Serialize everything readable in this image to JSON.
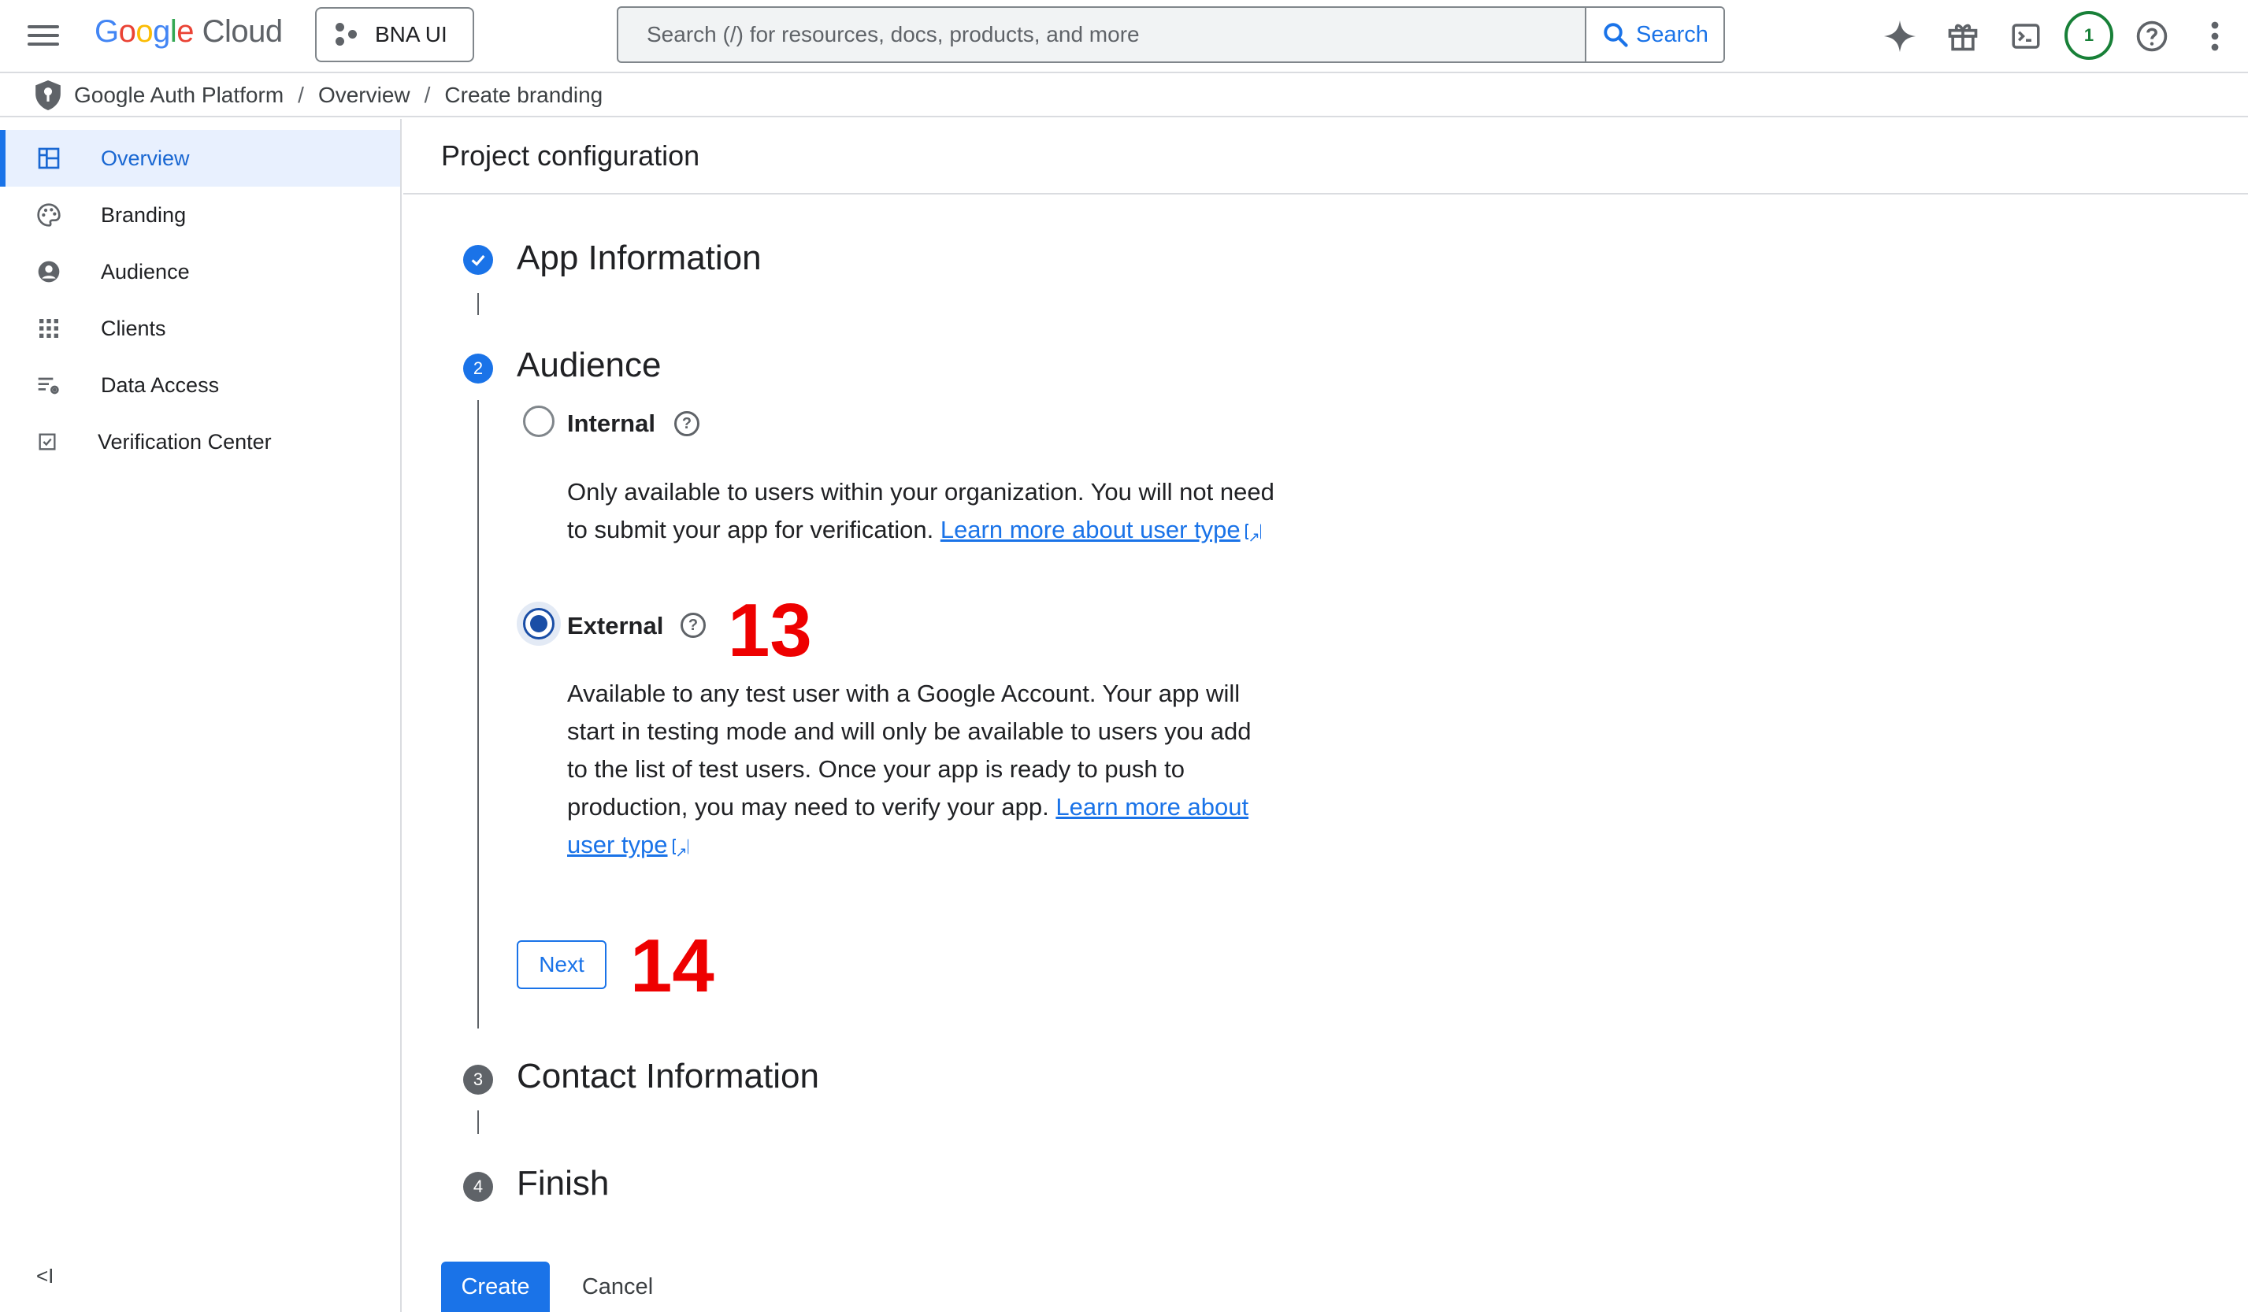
{
  "header": {
    "logo_google": [
      "G",
      "o",
      "o",
      "g",
      "l",
      "e"
    ],
    "logo_cloud": "Cloud",
    "project_name": "BNA UI",
    "search_placeholder": "Search (/) for resources, docs, products, and more",
    "search_button": "Search",
    "account_badge": "1",
    "icons": [
      "menu-icon",
      "gemini-sparkle-icon",
      "gift-icon",
      "cloud-shell-icon",
      "help-icon",
      "more-vert-icon"
    ]
  },
  "breadcrumb": [
    "Google Auth Platform",
    "Overview",
    "Create branding"
  ],
  "sidebar": {
    "items": [
      {
        "label": "Overview",
        "icon": "dashboard-icon",
        "active": true
      },
      {
        "label": "Branding",
        "icon": "palette-icon",
        "active": false
      },
      {
        "label": "Audience",
        "icon": "account-circle-icon",
        "active": false
      },
      {
        "label": "Clients",
        "icon": "apps-grid-icon",
        "active": false
      },
      {
        "label": "Data Access",
        "icon": "data-settings-icon",
        "active": false
      },
      {
        "label": "Verification Center",
        "icon": "verified-check-icon",
        "active": false
      }
    ],
    "collapse_label": "<I"
  },
  "main": {
    "title": "Project configuration",
    "steps": [
      {
        "number": "✓",
        "title": "App Information",
        "state": "complete"
      },
      {
        "number": "2",
        "title": "Audience",
        "state": "active"
      },
      {
        "number": "3",
        "title": "Contact Information",
        "state": "pending"
      },
      {
        "number": "4",
        "title": "Finish",
        "state": "pending"
      }
    ],
    "audience": {
      "internal": {
        "label": "Internal",
        "selected": false,
        "description": "Only available to users within your organization. You will not need to submit your app for verification. ",
        "link": "Learn more about user type"
      },
      "external": {
        "label": "External",
        "selected": true,
        "description": "Available to any test user with a Google Account. Your app will start in testing mode and will only be available to users you add to the list of test users. Once your app is ready to push to production, you may need to verify your app. ",
        "link": "Learn more about user type"
      }
    },
    "next_button": "Next",
    "create_button": "Create",
    "cancel_button": "Cancel"
  },
  "annotations": {
    "external_marker": "13",
    "next_marker": "14",
    "color": "#ee0000"
  },
  "colors": {
    "accent": "#1a73e8",
    "account_ring": "#188038",
    "active_nav_bg": "#e8f0fe"
  }
}
